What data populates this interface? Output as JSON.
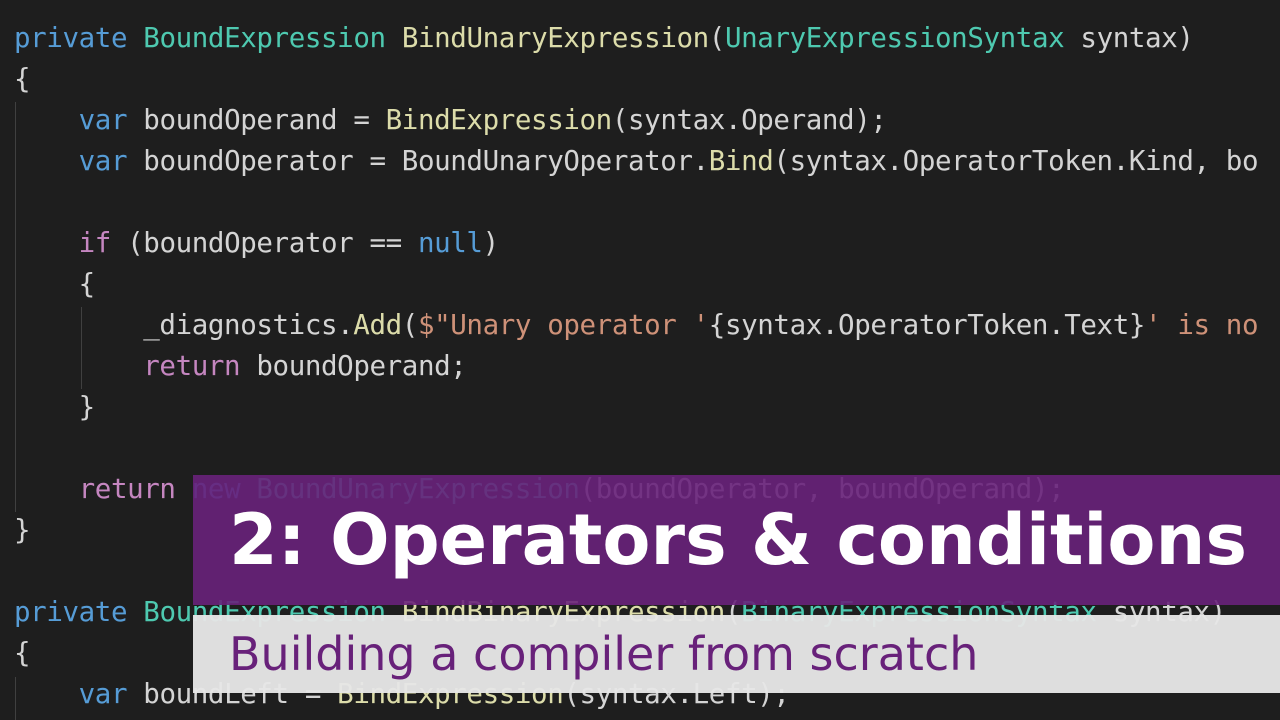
{
  "code": {
    "lines": [
      [
        [
          "kw",
          "private"
        ],
        [
          "txt",
          " "
        ],
        [
          "typ",
          "BoundExpression"
        ],
        [
          "txt",
          " "
        ],
        [
          "fn",
          "BindUnaryExpression"
        ],
        [
          "txt",
          "("
        ],
        [
          "typ",
          "UnaryExpressionSyntax"
        ],
        [
          "txt",
          " syntax)"
        ]
      ],
      [
        [
          "txt",
          "{"
        ]
      ],
      [
        [
          "txt",
          "    "
        ],
        [
          "kw",
          "var"
        ],
        [
          "txt",
          " boundOperand = "
        ],
        [
          "fn",
          "BindExpression"
        ],
        [
          "txt",
          "(syntax.Operand);"
        ]
      ],
      [
        [
          "txt",
          "    "
        ],
        [
          "kw",
          "var"
        ],
        [
          "txt",
          " boundOperator = BoundUnaryOperator."
        ],
        [
          "fn",
          "Bind"
        ],
        [
          "txt",
          "(syntax.OperatorToken.Kind, bo"
        ]
      ],
      [
        [
          "txt",
          ""
        ]
      ],
      [
        [
          "txt",
          "    "
        ],
        [
          "ctl",
          "if"
        ],
        [
          "txt",
          " (boundOperator == "
        ],
        [
          "kw",
          "null"
        ],
        [
          "txt",
          ")"
        ]
      ],
      [
        [
          "txt",
          "    {"
        ]
      ],
      [
        [
          "txt",
          "        _diagnostics."
        ],
        [
          "fn",
          "Add"
        ],
        [
          "txt",
          "("
        ],
        [
          "str",
          "$\"Unary operator '"
        ],
        [
          "txt",
          "{syntax.OperatorToken.Text}"
        ],
        [
          "str",
          "' is no"
        ]
      ],
      [
        [
          "txt",
          "        "
        ],
        [
          "ctl",
          "return"
        ],
        [
          "txt",
          " boundOperand;"
        ]
      ],
      [
        [
          "txt",
          "    }"
        ]
      ],
      [
        [
          "txt",
          ""
        ]
      ],
      [
        [
          "txt",
          "    "
        ],
        [
          "ctl",
          "return"
        ],
        [
          "txt",
          " "
        ],
        [
          "kw",
          "new"
        ],
        [
          "txt",
          " "
        ],
        [
          "typ",
          "BoundUnaryExpression"
        ],
        [
          "txt",
          "(boundOperator, boundOperand);"
        ]
      ],
      [
        [
          "txt",
          "}"
        ]
      ],
      [
        [
          "txt",
          ""
        ]
      ],
      [
        [
          "kw",
          "private"
        ],
        [
          "txt",
          " "
        ],
        [
          "typ",
          "BoundExpression"
        ],
        [
          "txt",
          " "
        ],
        [
          "fn",
          "BindBinaryExpression"
        ],
        [
          "txt",
          "("
        ],
        [
          "typ",
          "BinaryExpressionSyntax"
        ],
        [
          "txt",
          " syntax)"
        ]
      ],
      [
        [
          "txt",
          "{"
        ]
      ],
      [
        [
          "txt",
          "    "
        ],
        [
          "kw",
          "var"
        ],
        [
          "txt",
          " boundLeft = "
        ],
        [
          "fn",
          "BindExpression"
        ],
        [
          "txt",
          "(syntax.Left);"
        ]
      ]
    ]
  },
  "banner": {
    "title": "2: Operators & conditions",
    "subtitle": "Building a compiler from scratch"
  },
  "colors": {
    "background": "#1e1e1e",
    "keyword": "#569cd6",
    "control": "#c586c0",
    "type": "#4ec9b0",
    "function": "#dcdcaa",
    "string": "#ce9178",
    "text": "#d4d4d4",
    "title_banner": "#68217a",
    "subtitle_banner": "#e6e6e6"
  }
}
